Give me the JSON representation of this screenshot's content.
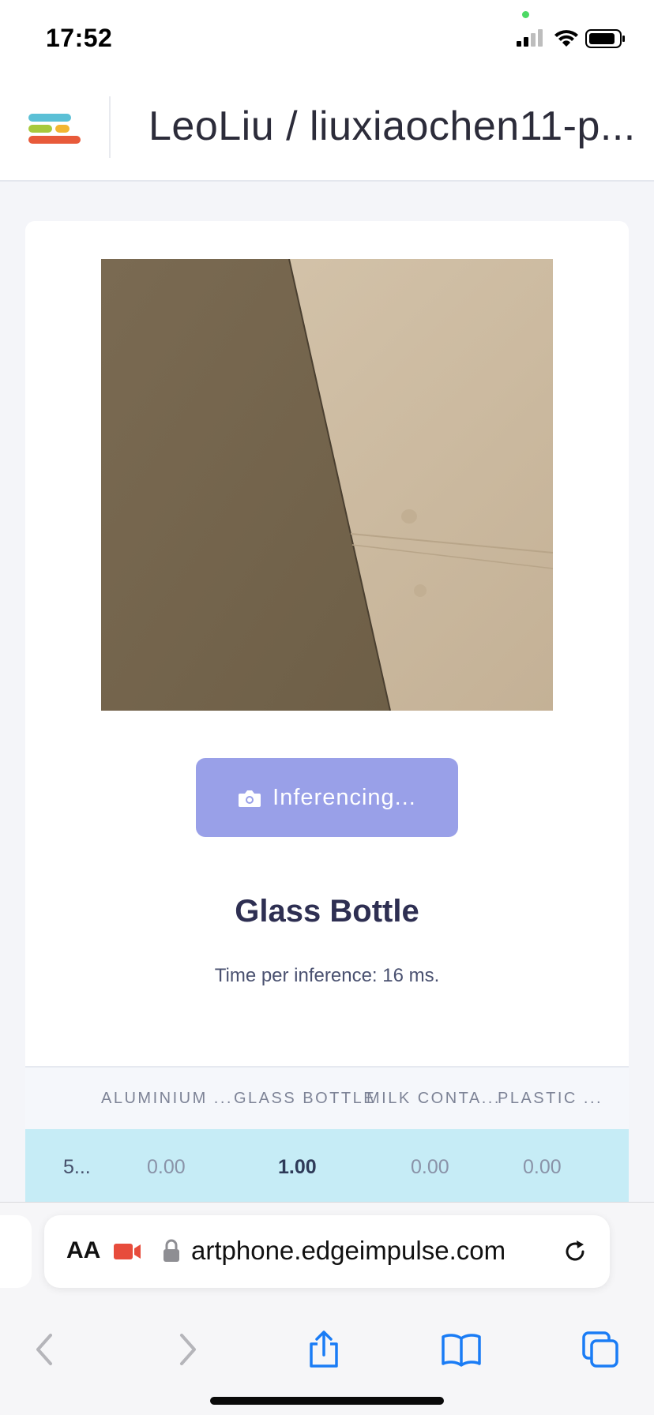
{
  "status_bar": {
    "time": "17:52",
    "icons": [
      "cellular-signal-icon",
      "wifi-icon",
      "battery-icon"
    ]
  },
  "header": {
    "title": "LeoLiu / liuxiaochen11-p...",
    "logo_icon": "edge-impulse-logo-icon"
  },
  "inference": {
    "button_label": "Inferencing...",
    "button_icon": "camera-icon",
    "result_label": "Glass Bottle",
    "timing_text": "Time per inference: 16 ms."
  },
  "results_table": {
    "columns": [
      "",
      "ALUMINIUM ...",
      "GLASS BOTTLE",
      "MILK CONTA...",
      "PLASTIC ..."
    ],
    "rows": [
      [
        "5...",
        "0.00",
        "1.00",
        "0.00",
        "0.00"
      ]
    ]
  },
  "browser": {
    "text_size_label": "AA",
    "url": "artphone.edgeimpulse.com",
    "icons": [
      "camera-recording-icon",
      "lock-icon",
      "reload-icon",
      "back-icon",
      "forward-icon",
      "share-icon",
      "bookmarks-icon",
      "tabs-icon"
    ]
  },
  "colors": {
    "button": "#99a0e8",
    "row_highlight": "#c6ecf6",
    "result_text": "#2e2f52",
    "recording_red": "#e74c3c",
    "browser_blue": "#1a7cf5"
  }
}
